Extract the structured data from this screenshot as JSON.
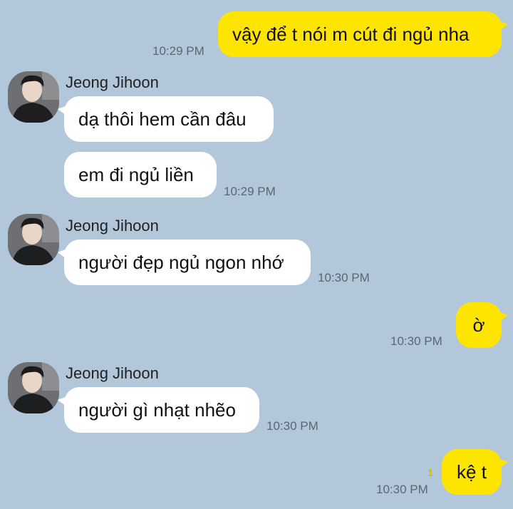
{
  "messages": [
    {
      "id": "m1",
      "side": "me",
      "text": "vậy để t nói m cút đi ngủ nha",
      "time": "10:29 PM"
    },
    {
      "id": "m2",
      "side": "them",
      "sender": "Jeong Jihoon",
      "text": "dạ thôi hem cần đâu"
    },
    {
      "id": "m3",
      "side": "them",
      "text": "em đi ngủ liền",
      "time": "10:29 PM"
    },
    {
      "id": "m4",
      "side": "them",
      "sender": "Jeong Jihoon",
      "text": "người đẹp ngủ ngon nhớ",
      "time": "10:30 PM"
    },
    {
      "id": "m5",
      "side": "me",
      "text": "ờ",
      "time": "10:30 PM"
    },
    {
      "id": "m6",
      "side": "them",
      "sender": "Jeong Jihoon",
      "text": "người gì nhạt nhẽo",
      "time": "10:30 PM"
    },
    {
      "id": "m7",
      "side": "me",
      "text": "kệ t",
      "time": "10:30 PM",
      "unread": "1"
    }
  ],
  "colors": {
    "background": "#b2c7da",
    "my_bubble": "#fee500",
    "their_bubble": "#ffffff",
    "unread": "#d8bc00"
  },
  "icons": {
    "avatar": "profile-photo-avatar"
  }
}
